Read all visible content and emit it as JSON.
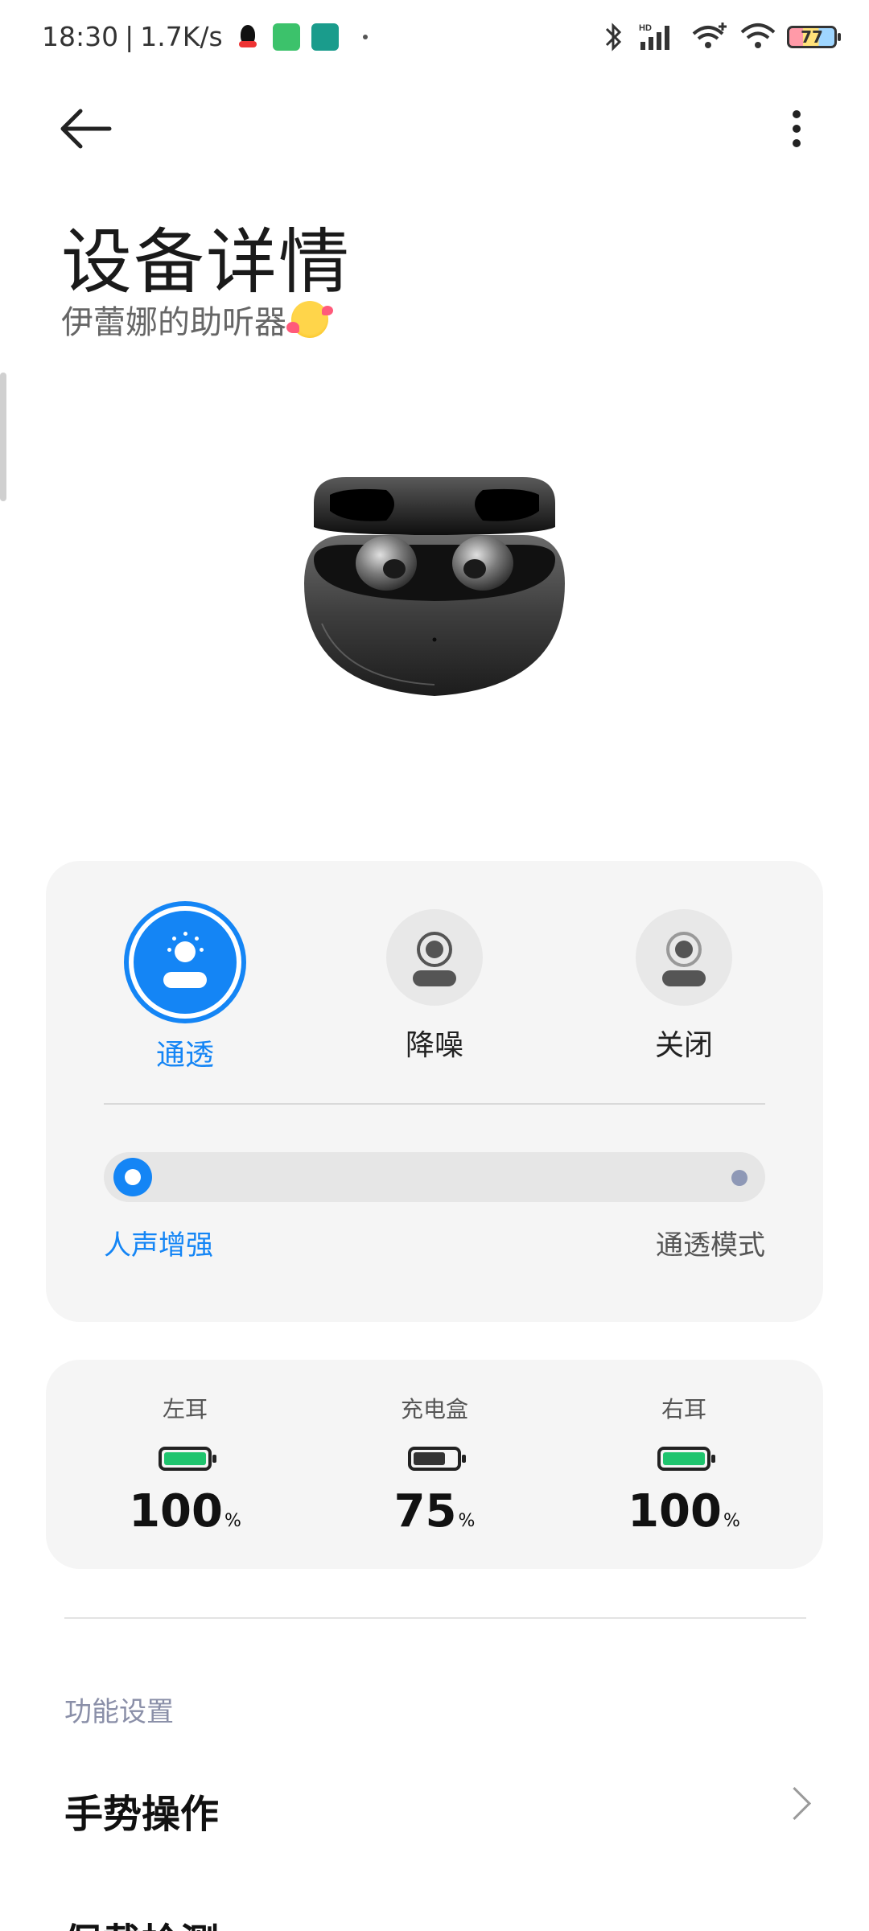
{
  "status_bar": {
    "time": "18:30",
    "speed": "1.7K/s",
    "network": "HD",
    "battery_level": "77"
  },
  "header": {
    "title": "设备详情",
    "subtitle": "伊蕾娜的助听器"
  },
  "anc": {
    "modes": [
      {
        "label": "通透",
        "active": true
      },
      {
        "label": "降噪",
        "active": false
      },
      {
        "label": "关闭",
        "active": false
      }
    ],
    "slider": {
      "left_label": "人声增强",
      "right_label": "通透模式",
      "position": 0
    }
  },
  "battery": {
    "items": [
      {
        "name": "左耳",
        "value": "100",
        "unit": "%",
        "level": 1.0,
        "color": "#1fc46e"
      },
      {
        "name": "充电盒",
        "value": "75",
        "unit": "%",
        "level": 0.75,
        "color": "#333333"
      },
      {
        "name": "右耳",
        "value": "100",
        "unit": "%",
        "level": 1.0,
        "color": "#1fc46e"
      }
    ]
  },
  "features": {
    "section_title": "功能设置",
    "items": [
      {
        "label": "手势操作"
      },
      {
        "label": "佩戴检测"
      }
    ]
  },
  "colors": {
    "accent": "#1485f5",
    "battery_green": "#1fc46e"
  }
}
